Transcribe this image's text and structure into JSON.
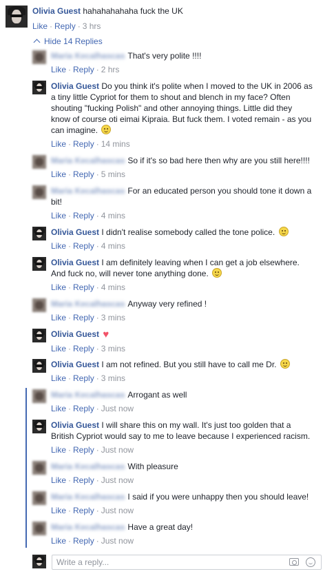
{
  "top": {
    "author": "Olivia Guest",
    "text": "hahahahahaha fuck the UK",
    "like": "Like",
    "reply": "Reply",
    "time": "3 hrs"
  },
  "hide_replies": "Hide 14 Replies",
  "replies": [
    {
      "author": "Maria Kecalhascas",
      "blurred": true,
      "text": "That's very polite !!!!",
      "time": "2 hrs"
    },
    {
      "author": "Olivia Guest",
      "blurred": false,
      "text": "Do you think it's polite when I moved to the UK in 2006 as a tiny little Cypriot for them to shout and blench in my face? Often shouting \"fucking Polish\" and other annoying things. Little did they know of course oti eimai Kipraia. But fuck them. I voted remain - as you can imagine.",
      "emoji": "smile",
      "time": "14 mins"
    },
    {
      "author": "Maria Kecalhascas",
      "blurred": true,
      "text": "So if it's so bad here then why are you still here!!!!",
      "time": "5 mins"
    },
    {
      "author": "Maria Kecalhascas",
      "blurred": true,
      "text": "For an educated person you should tone it down a bit!",
      "time": "4 mins"
    },
    {
      "author": "Olivia Guest",
      "blurred": false,
      "text": "I didn't realise somebody called the tone police.",
      "emoji": "smile",
      "time": "4 mins"
    },
    {
      "author": "Olivia Guest",
      "blurred": false,
      "text": "I am definitely leaving when I can get a job elsewhere. And fuck no, will never tone anything done.",
      "emoji": "smile",
      "time": "4 mins"
    },
    {
      "author": "Maria Kecalhascas",
      "blurred": true,
      "text": "Anyway very refined !",
      "time": "3 mins"
    },
    {
      "author": "Olivia Guest",
      "blurred": false,
      "text": "",
      "emoji": "heart",
      "time": "3 mins"
    },
    {
      "author": "Olivia Guest",
      "blurred": false,
      "text": "I am not refined. But you still have to call me Dr.",
      "emoji": "smile",
      "time": "3 mins"
    },
    {
      "author": "Maria Kecalhascas",
      "blurred": true,
      "text": "Arrogant as well",
      "time": "Just now"
    },
    {
      "author": "Olivia Guest",
      "blurred": false,
      "text": "I will share this on my wall. It's just too golden that a British Cypriot would say to me to leave because I experienced racism.",
      "time": "Just now"
    },
    {
      "author": "Maria Kecalhascas",
      "blurred": true,
      "text": "With pleasure",
      "time": "Just now"
    },
    {
      "author": "Maria Kecalhascas",
      "blurred": true,
      "text": "I said if you were unhappy then you should leave!",
      "time": "Just now"
    },
    {
      "author": "Maria Kecalhascas",
      "blurred": true,
      "text": "Have a great day!",
      "time": "Just now"
    }
  ],
  "labels": {
    "like": "Like",
    "reply": "Reply"
  },
  "reply_box": {
    "placeholder": "Write a reply..."
  },
  "icons": {
    "camera": "camera-icon",
    "emoji": "emoji-icon"
  },
  "colors": {
    "link": "#4267b2",
    "name": "#365899",
    "meta": "#90949c",
    "thread": "#4267b2"
  }
}
